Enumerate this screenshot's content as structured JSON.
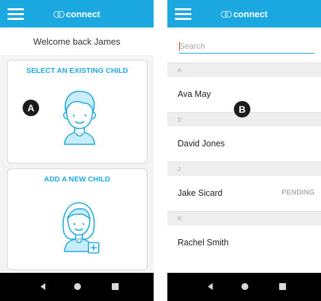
{
  "app": {
    "brand_name": "connect",
    "accent_color": "#1ba8e0"
  },
  "screen_a": {
    "welcome_text": "Welcome back James",
    "cards": [
      {
        "title": "SELECT AN EXISTING CHILD",
        "icon": "boy-avatar-icon"
      },
      {
        "title": "ADD A NEW CHILD",
        "icon": "girl-avatar-add-icon"
      }
    ],
    "marker": "A"
  },
  "screen_b": {
    "search": {
      "placeholder": "Search",
      "value": ""
    },
    "sections": [
      {
        "letter": "A",
        "rows": [
          {
            "name": "Ava May",
            "status": ""
          }
        ]
      },
      {
        "letter": "D",
        "rows": [
          {
            "name": "David Jones",
            "status": ""
          }
        ]
      },
      {
        "letter": "J",
        "rows": [
          {
            "name": "Jake Sicard",
            "status": "PENDING"
          }
        ]
      },
      {
        "letter": "R",
        "rows": [
          {
            "name": "Rachel Smith",
            "status": ""
          }
        ]
      }
    ],
    "marker": "B"
  },
  "system_nav": {
    "icons": [
      "back-icon",
      "home-icon",
      "recent-apps-icon"
    ]
  }
}
